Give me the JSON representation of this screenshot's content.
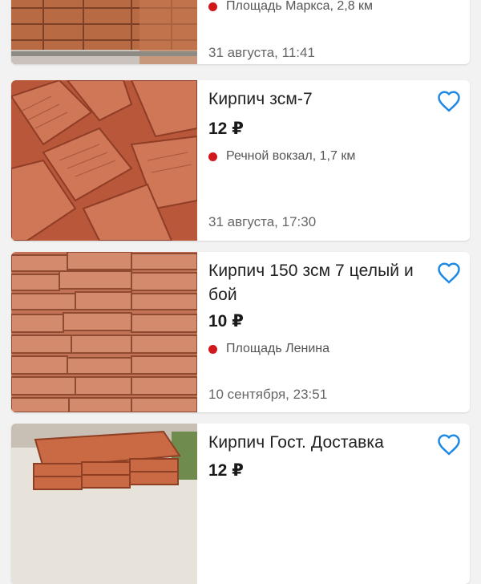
{
  "listings": [
    {
      "title": "",
      "price": "",
      "location": "Площадь Маркса, 2,8 км",
      "date": "31 августа, 11:41"
    },
    {
      "title": "Кирпич зсм-7",
      "price": "12 ₽",
      "location": "Речной вокзал, 1,7 км",
      "date": "31 августа, 17:30"
    },
    {
      "title": "Кирпич 150 зсм 7 целый и бой",
      "price": "10 ₽",
      "location": "Площадь Ленина",
      "date": "10 сентября, 23:51"
    },
    {
      "title": "Кирпич Гост. Доставка",
      "price": "12 ₽",
      "location": "",
      "date": ""
    }
  ],
  "colors": {
    "accent": "#1e88e5",
    "metro_dot": "#d0171b",
    "card_bg": "#ffffff",
    "page_bg": "#f2f2f2"
  },
  "icons": {
    "favorite": "heart-outline-icon",
    "metro": "red-dot-icon"
  }
}
